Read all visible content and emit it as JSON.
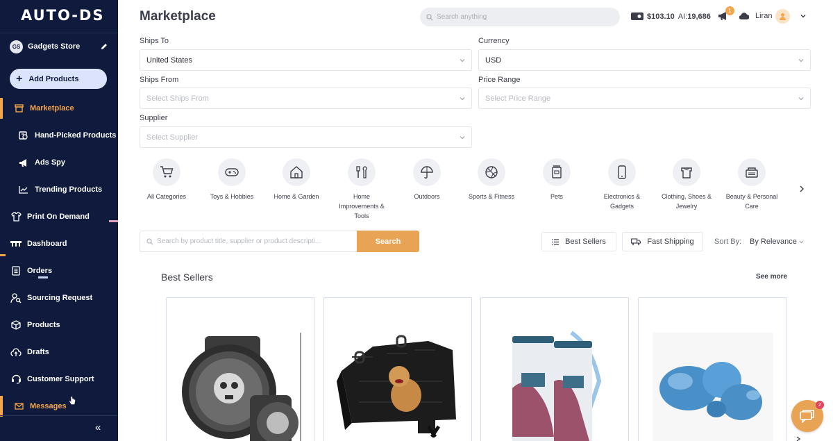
{
  "sidebar": {
    "logo": "AUTO-DS",
    "store": {
      "initials": "GS",
      "name": "Gadgets Store"
    },
    "add_products": "Add Products",
    "items": [
      {
        "label": "Marketplace",
        "icon": "store-icon"
      },
      {
        "label": "Hand-Picked Products",
        "icon": "hand-picked-icon"
      },
      {
        "label": "Ads Spy",
        "icon": "megaphone-icon"
      },
      {
        "label": "Trending Products",
        "icon": "trending-icon"
      },
      {
        "label": "Print On Demand",
        "icon": "tshirt-icon"
      },
      {
        "label": "Dashboard",
        "icon": "dashboard-icon"
      },
      {
        "label": "Orders",
        "icon": "orders-icon"
      },
      {
        "label": "Sourcing Request",
        "icon": "sourcing-icon"
      },
      {
        "label": "Products",
        "icon": "box-icon"
      },
      {
        "label": "Drafts",
        "icon": "cloud-upload-icon"
      },
      {
        "label": "Customer Support",
        "icon": "headset-icon"
      },
      {
        "label": "Messages",
        "icon": "mail-icon"
      }
    ],
    "collapse": "«"
  },
  "header": {
    "title": "Marketplace",
    "search_placeholder": "Search anything",
    "balance": "$103.10",
    "ai_label": "AI:",
    "ai_credits": "19,686",
    "notification_count": "1",
    "user_name": "Liran"
  },
  "filters": {
    "ships_to": {
      "label": "Ships To",
      "value": "United States"
    },
    "currency": {
      "label": "Currency",
      "value": "USD"
    },
    "ships_from": {
      "label": "Ships From",
      "placeholder": "Select Ships From"
    },
    "price_range": {
      "label": "Price Range",
      "placeholder": "Select Price Range"
    },
    "supplier": {
      "label": "Supplier",
      "placeholder": "Select Supplier"
    }
  },
  "categories": [
    {
      "label": "All Categories",
      "icon": "cart-icon"
    },
    {
      "label": "Toys & Hobbies",
      "icon": "gamepad-icon"
    },
    {
      "label": "Home & Garden",
      "icon": "house-icon"
    },
    {
      "label": "Home Improvements & Tools",
      "icon": "tools-icon"
    },
    {
      "label": "Outdoors",
      "icon": "umbrella-icon"
    },
    {
      "label": "Sports & Fitness",
      "icon": "ball-icon"
    },
    {
      "label": "Pets",
      "icon": "pet-food-icon"
    },
    {
      "label": "Electronics & Gadgets",
      "icon": "phone-icon"
    },
    {
      "label": "Clothing, Shoes & Jewelry",
      "icon": "shirt-icon"
    },
    {
      "label": "Beauty & Personal Care",
      "icon": "beauty-icon"
    }
  ],
  "product_search": {
    "placeholder": "Search by product title, supplier or product descripti...",
    "button": "Search"
  },
  "toolbar": {
    "best_sellers": "Best Sellers",
    "fast_shipping": "Fast Shipping",
    "sort_label": "Sort By:",
    "sort_value": "By Relevance"
  },
  "best_sellers": {
    "title": "Best Sellers",
    "see_more": "See more"
  },
  "chat": {
    "badge": "2"
  },
  "colors": {
    "sidebar_bg": "#0f1a3d",
    "accent": "#f5a64b",
    "search_button": "#e8a454",
    "add_button_bg": "#dbe4fb"
  }
}
